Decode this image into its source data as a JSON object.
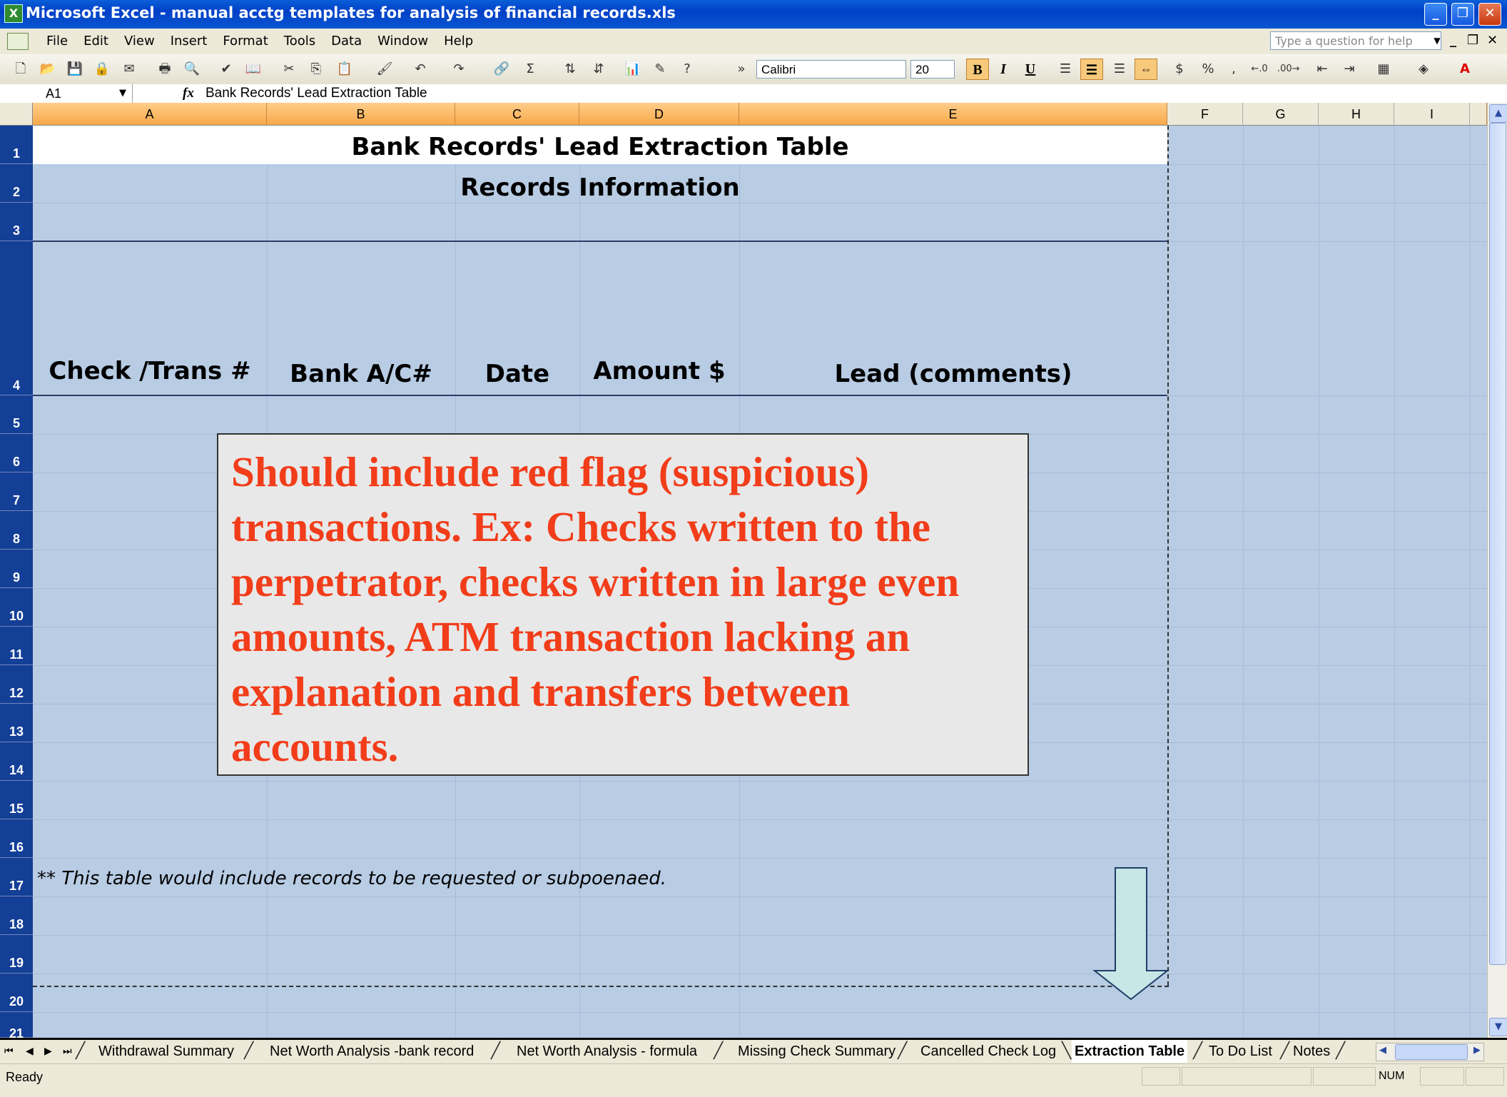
{
  "window": {
    "title": "Microsoft Excel - manual acctg templates for analysis of financial records.xls",
    "app_icon": "X",
    "colors": {
      "titlebar": "#0a56d0",
      "grid_bg": "#b8cce4",
      "row_header": "#143f96",
      "col_header": "#f8a94a",
      "callout_text": "#f23d1a"
    }
  },
  "menu": {
    "items": [
      "File",
      "Edit",
      "View",
      "Insert",
      "Format",
      "Tools",
      "Data",
      "Window",
      "Help"
    ],
    "help_placeholder": "Type a question for help"
  },
  "toolbar": {
    "font_name": "Calibri",
    "font_size": "20",
    "bold": "B",
    "italic": "I",
    "underline": "U",
    "currency": "$",
    "percent": "%",
    "comma": ",",
    "sum": "Σ"
  },
  "formula_bar": {
    "cell_ref": "A1",
    "fx": "fx",
    "content": "Bank Records' Lead Extraction Table"
  },
  "grid": {
    "columns": [
      "A",
      "B",
      "C",
      "D",
      "E",
      "F",
      "G",
      "H",
      "I"
    ],
    "rows": [
      "1",
      "2",
      "3",
      "4",
      "5",
      "6",
      "7",
      "8",
      "9",
      "10",
      "11",
      "12",
      "13",
      "14",
      "15",
      "16",
      "17",
      "18",
      "19",
      "20",
      "21"
    ],
    "title": "Bank Records' Lead Extraction Table",
    "subtitle": "Records Information",
    "headers": [
      "Check /Trans #",
      "Bank A/C#",
      "Date",
      "Amount $",
      "Lead  (comments)"
    ],
    "footnote": "** This table would include records to be requested or subpoenaed."
  },
  "callout": {
    "text": "Should include red flag (suspicious) transactions. Ex: Checks written to the perpetrator, checks written in large even amounts, ATM transaction lacking an explanation and transfers between accounts."
  },
  "sheet_tabs": {
    "tabs": [
      "Withdrawal Summary",
      "Net Worth Analysis -bank record",
      "Net Worth Analysis - formula",
      "Missing Check Summary",
      "Cancelled Check Log",
      "Extraction Table",
      "To Do List",
      "Notes"
    ],
    "active": "Extraction Table"
  },
  "status_bar": {
    "status": "Ready",
    "num_lock": "NUM"
  }
}
